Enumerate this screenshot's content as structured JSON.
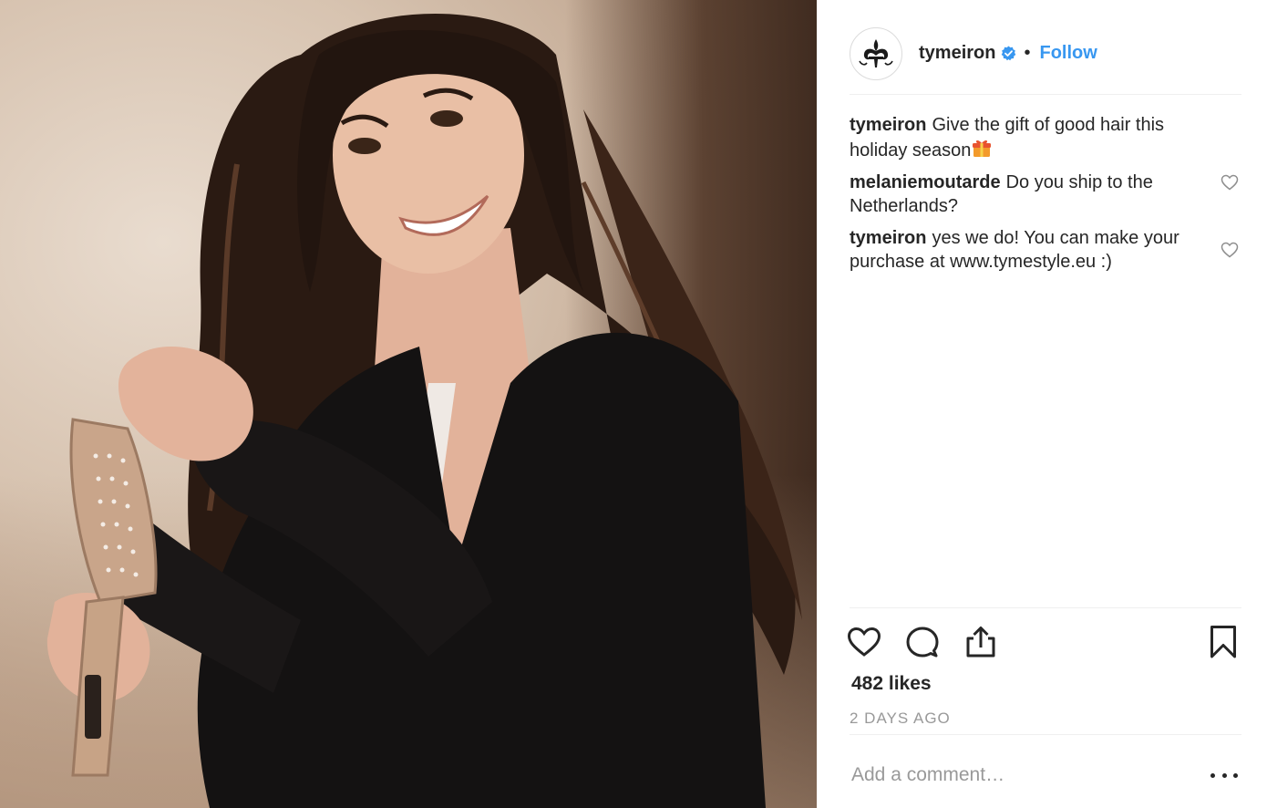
{
  "post": {
    "photo_alt": "tymeiron post photo",
    "header": {
      "username": "tymeiron",
      "separator": "•",
      "follow_label": "Follow"
    },
    "comments": [
      {
        "author": "tymeiron",
        "text": "Give the gift of good hair this holiday season",
        "emoji": "gift-icon",
        "likeable": false
      },
      {
        "author": "melaniemoutarde",
        "text": "Do you ship to the Netherlands?",
        "likeable": true
      },
      {
        "author": "tymeiron",
        "text": "yes we do! You can make your purchase at www.tymestyle.eu :)",
        "likeable": true
      }
    ],
    "actions": {
      "like": "heart-icon",
      "comment": "speech-bubble-icon",
      "share": "share-icon",
      "save": "bookmark-icon"
    },
    "likes_label": "482 likes",
    "timestamp": "2 DAYS AGO",
    "add_comment_placeholder": "Add a comment…",
    "colors": {
      "accent": "#3897f0",
      "text": "#262626",
      "muted": "#999999",
      "divider": "#efefef"
    }
  }
}
